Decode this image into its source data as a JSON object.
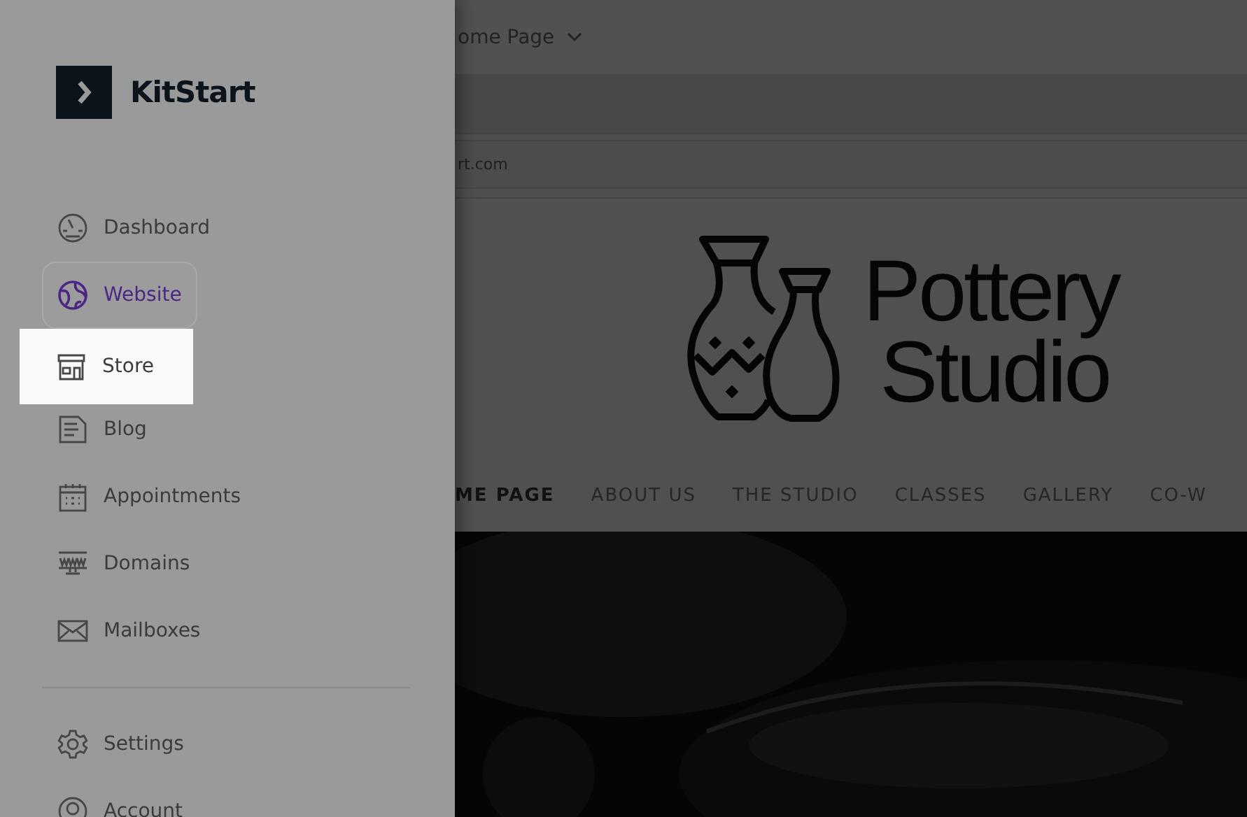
{
  "sidebar": {
    "logo": "KitStart",
    "items": [
      {
        "label": "Dashboard",
        "selected": false,
        "hovered": false
      },
      {
        "label": "Website",
        "selected": true,
        "hovered": false
      },
      {
        "label": "Store",
        "selected": false,
        "hovered": true
      },
      {
        "label": "Blog",
        "selected": false,
        "hovered": false
      },
      {
        "label": "Appointments",
        "selected": false,
        "hovered": false
      },
      {
        "label": "Domains",
        "selected": false,
        "hovered": false
      },
      {
        "label": "Mailboxes",
        "selected": false,
        "hovered": false
      }
    ],
    "footer_items": [
      {
        "label": "Settings"
      },
      {
        "label": "Account"
      }
    ]
  },
  "page": {
    "page_select": "ome Page",
    "url": "rt.com",
    "site_title": [
      "Pottery",
      "Studio"
    ],
    "nav": [
      {
        "label": "ME PAGE",
        "selected": true
      },
      {
        "label": "ABOUT US",
        "selected": false
      },
      {
        "label": "THE STUDIO",
        "selected": false
      },
      {
        "label": "CLASSES",
        "selected": false
      },
      {
        "label": "GALLERY",
        "selected": false
      },
      {
        "label": "CO-W",
        "selected": false
      }
    ]
  }
}
